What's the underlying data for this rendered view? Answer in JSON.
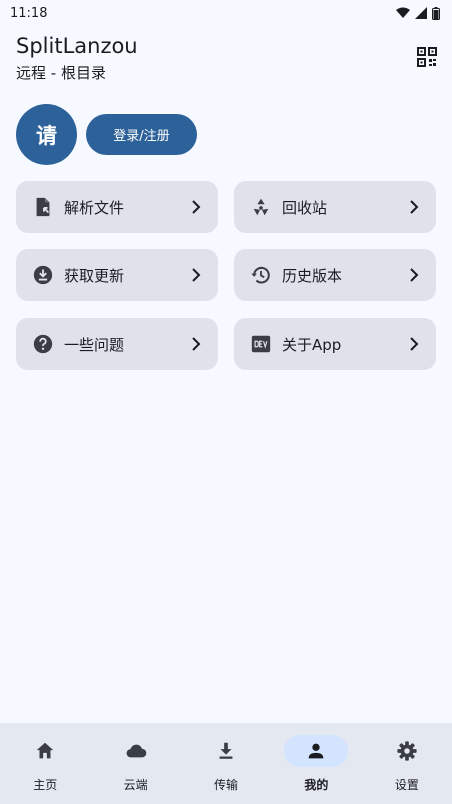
{
  "status_bar": {
    "time": "11:18",
    "icons": [
      "wifi-icon",
      "signal-icon",
      "battery-icon"
    ]
  },
  "header": {
    "title": "SplitLanzou",
    "subtitle": "远程 - 根目录",
    "scan_icon": "qr-scan-icon"
  },
  "profile": {
    "avatar_text": "请",
    "login_label": "登录/注册"
  },
  "cards": [
    {
      "label": "解析文件",
      "icon": "file-parse-icon"
    },
    {
      "label": "回收站",
      "icon": "recycle-icon"
    },
    {
      "label": "获取更新",
      "icon": "download-circle-icon"
    },
    {
      "label": "历史版本",
      "icon": "history-icon"
    },
    {
      "label": "一些问题",
      "icon": "help-icon"
    },
    {
      "label": "关于App",
      "icon": "dev-icon"
    }
  ],
  "bottom_nav": {
    "items": [
      {
        "label": "主页",
        "icon": "home-icon"
      },
      {
        "label": "云端",
        "icon": "cloud-icon"
      },
      {
        "label": "传输",
        "icon": "download-icon"
      },
      {
        "label": "我的",
        "icon": "person-icon"
      },
      {
        "label": "设置",
        "icon": "gear-icon"
      }
    ],
    "active_index": 3
  },
  "colors": {
    "background": "#f6f9ff",
    "primary": "#2d6199",
    "card": "#dfe2eb",
    "nav_background": "#e4e8f0",
    "nav_active_pill": "#d3e4ff",
    "text": "#1a1c20"
  }
}
